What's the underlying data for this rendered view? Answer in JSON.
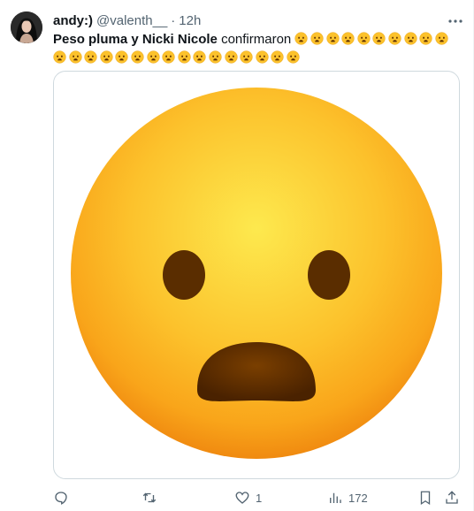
{
  "author": {
    "name": "andy:)",
    "handle": "@valenth__",
    "separator": "·",
    "time": "12h"
  },
  "tweet": {
    "bold_text": "Peso pluma y Nicki Nicole",
    "text": "confirmaron",
    "emoji_name": "frowning-face-open-mouth",
    "emoji_count_line1": 11,
    "emoji_count_line2": 15
  },
  "media": {
    "image_description": "frowning-face-with-open-mouth-emoji"
  },
  "actions": {
    "reply_count": "",
    "retweet_count": "",
    "like_count": "1",
    "views_count": "172"
  },
  "colors": {
    "text": "#0f1419",
    "muted": "#536471",
    "border": "#cfd9de",
    "emoji_yellow": "#fbc02d"
  }
}
